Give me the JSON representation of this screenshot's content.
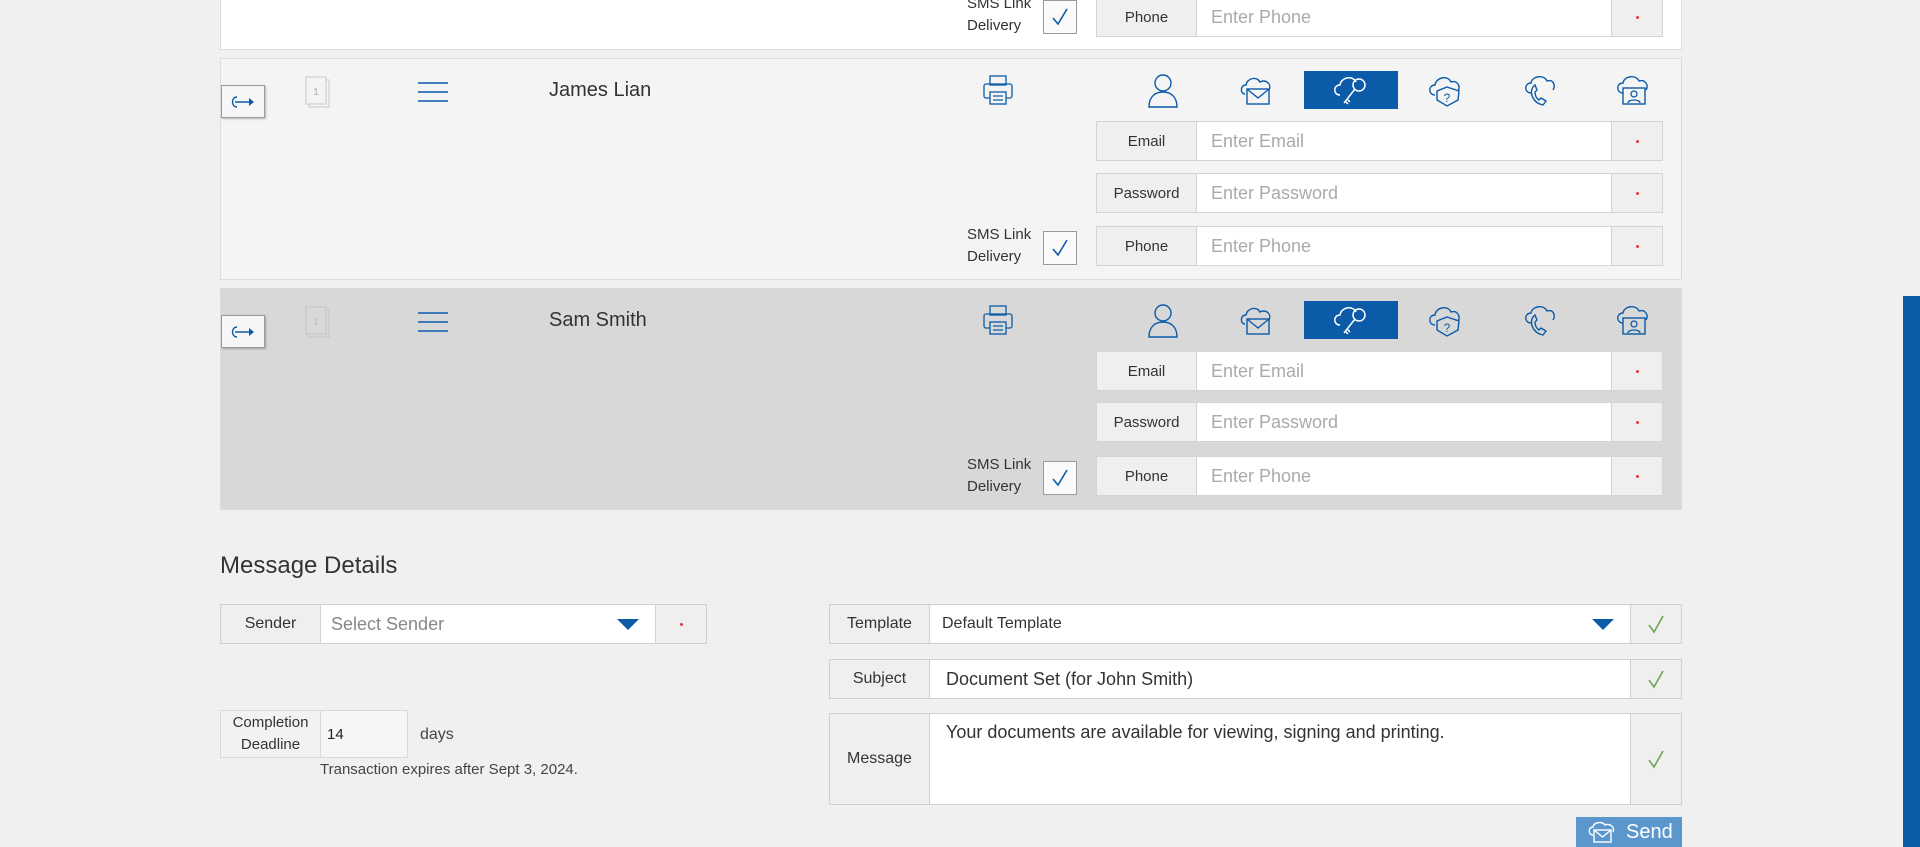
{
  "colors": {
    "accent": "#0c5ba8",
    "check_green": "#6aa84f",
    "required_red": "#e23b3b",
    "send_bg": "#5b97cd"
  },
  "top_partial": {
    "sms_label_line1": "SMS Link",
    "sms_label_line2": "Delivery",
    "phone_label": "Phone",
    "phone_placeholder": "Enter Phone"
  },
  "recipients": [
    {
      "name": "James Lian",
      "doc_number": "1",
      "email_label": "Email",
      "email_placeholder": "Enter Email",
      "password_label": "Password",
      "password_placeholder": "Enter Password",
      "phone_label": "Phone",
      "phone_placeholder": "Enter Phone",
      "sms_label_line1": "SMS Link",
      "sms_label_line2": "Delivery"
    },
    {
      "name": "Sam Smith",
      "doc_number": "1",
      "email_label": "Email",
      "email_placeholder": "Enter Email",
      "password_label": "Password",
      "password_placeholder": "Enter Password",
      "phone_label": "Phone",
      "phone_placeholder": "Enter Phone",
      "sms_label_line1": "SMS Link",
      "sms_label_line2": "Delivery"
    }
  ],
  "auth_icons": [
    "user-icon",
    "email-cloud-icon",
    "key-cloud-icon",
    "question-cloud-icon",
    "phone-cloud-icon",
    "id-cloud-icon"
  ],
  "auth_selected": "key-cloud-icon",
  "message_details": {
    "title": "Message Details",
    "sender_label": "Sender",
    "sender_placeholder": "Select Sender",
    "template_label": "Template",
    "template_value": "Default Template",
    "subject_label": "Subject",
    "subject_value": "Document Set (for John Smith)",
    "message_label": "Message",
    "message_value": "Your documents are available for viewing, signing and printing.",
    "deadline_label_line1": "Completion",
    "deadline_label_line2": "Deadline",
    "deadline_value": "14",
    "deadline_unit": "days",
    "expiry_note": "Transaction expires after Sept 3, 2024.",
    "send_label": "Send"
  }
}
